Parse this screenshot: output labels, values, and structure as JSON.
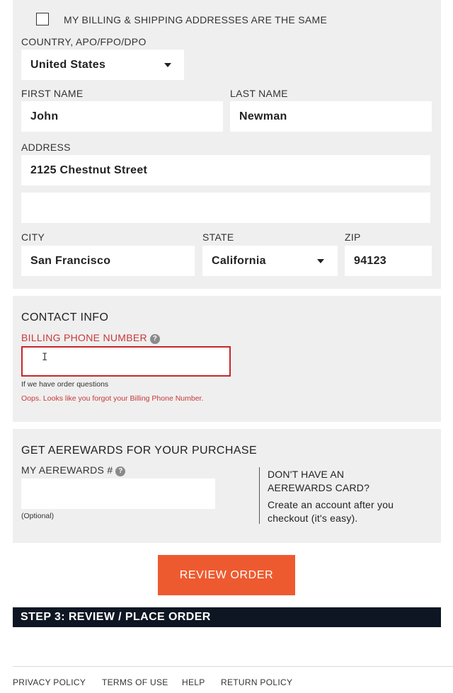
{
  "billing": {
    "same_address_label": "MY BILLING & SHIPPING ADDRESSES ARE THE SAME",
    "same_address_checked": false,
    "country_label": "COUNTRY, APO/FPO/DPO",
    "country_value": "United States",
    "first_name_label": "FIRST NAME",
    "first_name_value": "John",
    "last_name_label": "LAST NAME",
    "last_name_value": "Newman",
    "address_label": "ADDRESS",
    "address_line1": "2125 Chestnut Street",
    "address_line2": "",
    "city_label": "CITY",
    "city_value": "San Francisco",
    "state_label": "STATE",
    "state_value": "California",
    "zip_label": "ZIP",
    "zip_value": "94123"
  },
  "contact": {
    "title": "CONTACT INFO",
    "phone_label": "BILLING PHONE NUMBER",
    "phone_value": "",
    "help_glyph": "?",
    "hint": "If we have order questions",
    "error": "Oops. Looks like you forgot your Billing Phone Number."
  },
  "rewards": {
    "title": "GET AEREWARDS FOR YOUR PURCHASE",
    "number_label": "MY AEREWARDS #",
    "help_glyph": "?",
    "number_value": "",
    "optional": "(Optional)",
    "no_card_line1": "DON'T HAVE AN",
    "no_card_line2": "AEREWARDS CARD?",
    "create_line1": "Create an account after you",
    "create_line2": "checkout (it's easy)."
  },
  "actions": {
    "review_order": "REVIEW ORDER"
  },
  "step3": {
    "title": "STEP 3: REVIEW / PLACE ORDER"
  },
  "footer": {
    "privacy": "PRIVACY POLICY",
    "terms": "TERMS OF USE",
    "help": "HELP",
    "returns": "RETURN POLICY"
  },
  "colors": {
    "accent": "#ee5a2f",
    "error": "#c8262b",
    "step_bar": "#0e1623",
    "panel": "#efefef"
  },
  "icons": [
    "checkbox-icon",
    "dropdown-caret-icon",
    "help-icon",
    "text-cursor-icon"
  ]
}
